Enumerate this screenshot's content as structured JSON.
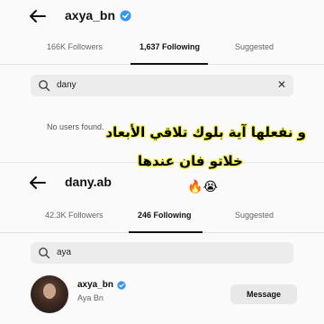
{
  "panel_a": {
    "username": "axya_bn",
    "tabs": [
      {
        "label": "166K Followers"
      },
      {
        "label": "1,637 Following"
      },
      {
        "label": "Suggested"
      }
    ],
    "search_value": "dany",
    "empty_text": "No users found."
  },
  "panel_b": {
    "username": "dany.ab",
    "tabs": [
      {
        "label": "42.3K Followers"
      },
      {
        "label": "246 Following"
      },
      {
        "label": "Suggested"
      }
    ],
    "search_value": "aya",
    "result": {
      "username": "axya_bn",
      "name": "Aya Bn",
      "button_label": "Message"
    }
  },
  "overlay": {
    "line1": "و نفعلها آية بلوك تلاقي الأبعاد",
    "line2": "خلاتو فان عندها",
    "line3": "😭🔥"
  },
  "colors": {
    "verified": "#3897f0",
    "overlay_highlight": "#eeee40"
  }
}
